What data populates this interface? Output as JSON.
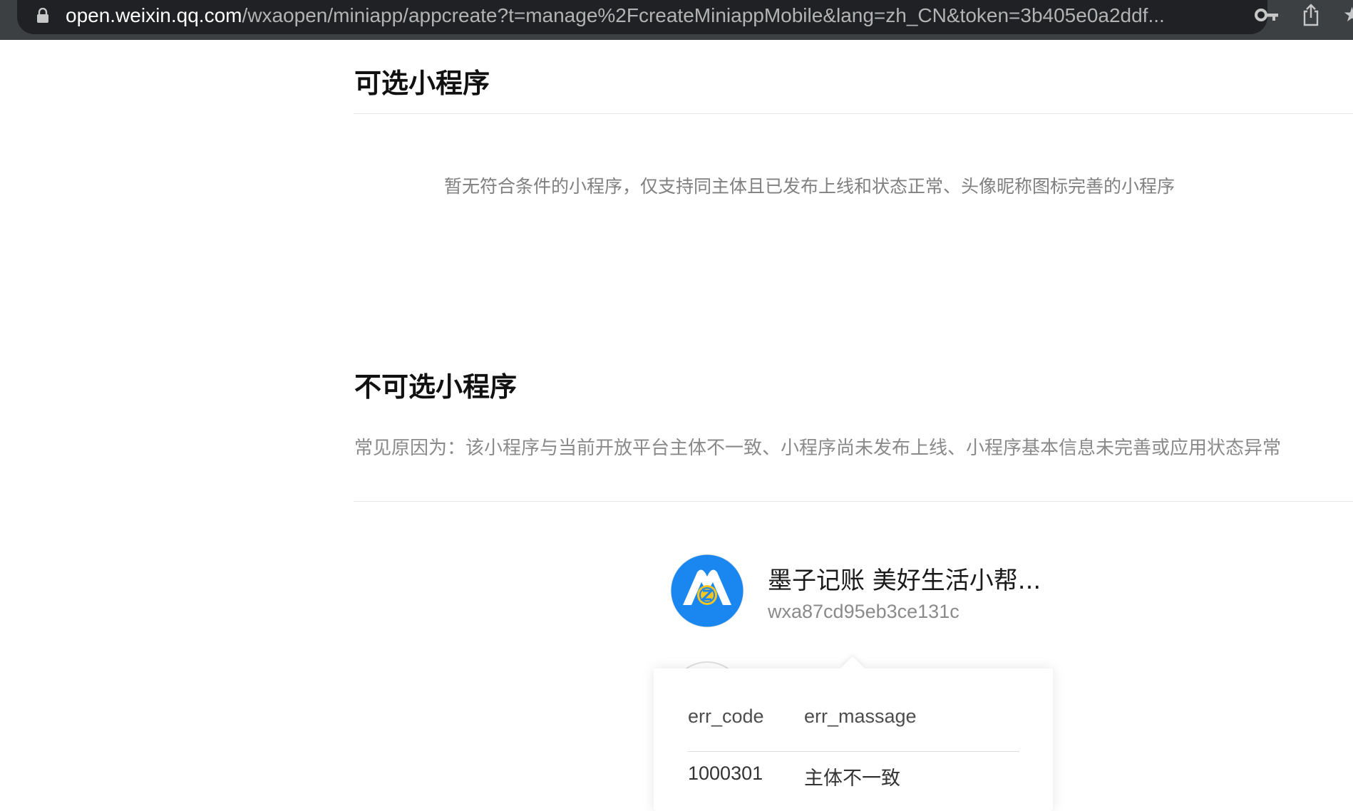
{
  "browser": {
    "url_host": "open.weixin.qq.com",
    "url_path": "/wxaopen/miniapp/appcreate?t=manage%2FcreateMiniappMobile&lang=zh_CN&token=3b405e0a2ddf..."
  },
  "icons": {
    "lock": "lock-icon",
    "key": "key-icon",
    "share": "share-icon",
    "star": "star-icon"
  },
  "selectable": {
    "title": "可选小程序",
    "empty_text": "暂无符合条件的小程序，仅支持同主体且已发布上线和状态正常、头像昵称图标完善的小程序"
  },
  "unselectable": {
    "title": "不可选小程序",
    "reason": "常见原因为：该小程序与当前开放平台主体不一致、小程序尚未发布上线、小程序基本信息未完善或应用状态异常",
    "apps": [
      {
        "name": "墨子记账 美好生活小帮...",
        "appid": "wxa87cd95eb3ce131c",
        "avatar_color": "#1a87f0",
        "badge_color": "#f6c51f"
      }
    ]
  },
  "popover": {
    "headers": [
      "err_code",
      "err_massage"
    ],
    "rows": [
      [
        "1000301",
        "主体不一致"
      ]
    ]
  }
}
